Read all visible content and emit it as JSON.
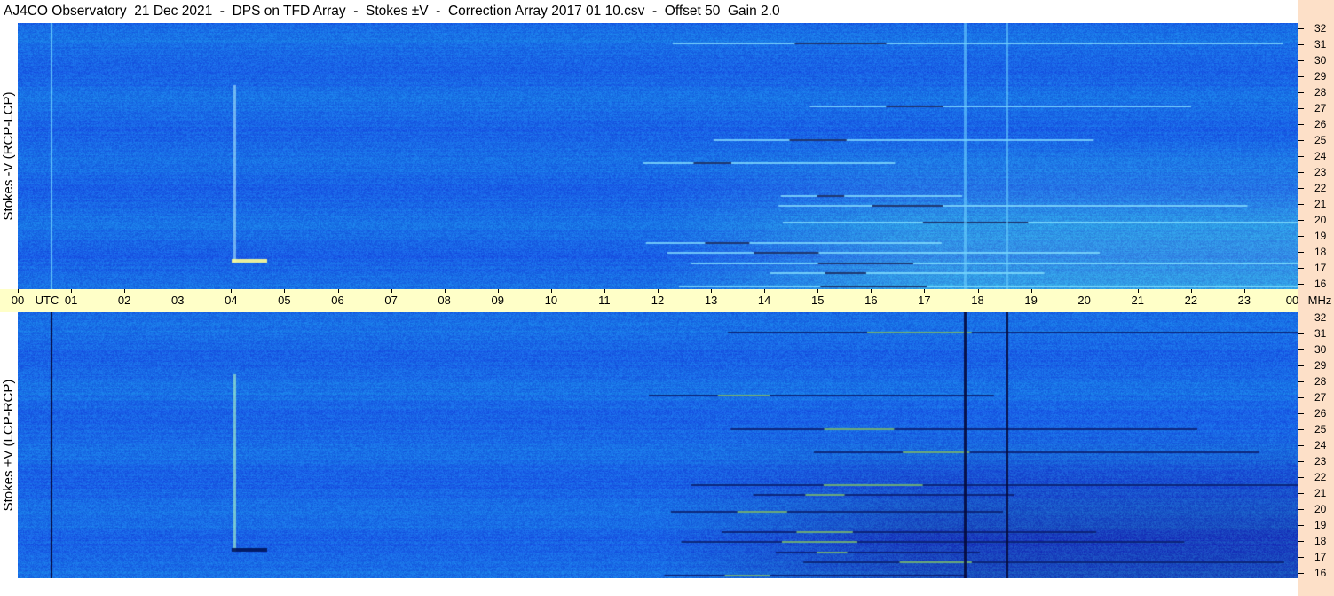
{
  "title": "AJ4CO Observatory  21 Dec 2021  -  DPS on TFD Array  -  Stokes ±V  -  Correction Array 2017 01 10.csv  -  Offset 50  Gain 2.0",
  "top_panel_label": "Stokes -V (RCP-LCP)",
  "bottom_panel_label": "Stokes +V (LCP-RCP)",
  "utc_axis": {
    "ticks": [
      "00",
      "01",
      "02",
      "03",
      "04",
      "05",
      "06",
      "07",
      "08",
      "09",
      "10",
      "11",
      "12",
      "13",
      "14",
      "15",
      "16",
      "17",
      "18",
      "19",
      "20",
      "21",
      "22",
      "23",
      "00"
    ],
    "unit_label": "UTC",
    "end_unit": "MHz"
  },
  "mhz_axis": {
    "ticks": [
      "32",
      "31",
      "30",
      "29",
      "28",
      "27",
      "26",
      "25",
      "24",
      "23",
      "22",
      "21",
      "20",
      "19",
      "18",
      "17",
      "16"
    ]
  },
  "colors": {
    "background_spectrogram": "#1b6be6",
    "utc_band": "#ffffc8",
    "right_strip": "#fde0c8"
  },
  "chart_data": {
    "type": "heatmap",
    "title": "AJ4CO Observatory  21 Dec 2021  -  DPS on TFD Array  -  Stokes ±V  -  Correction Array 2017 01 10.csv  -  Offset 50  Gain 2.0",
    "panels": [
      "Stokes -V (RCP-LCP)",
      "Stokes +V (LCP-RCP)"
    ],
    "x_axis": {
      "label": "UTC",
      "range": [
        0,
        24
      ],
      "unit": "hour"
    },
    "y_axis": {
      "label": "MHz",
      "range": [
        16,
        32
      ],
      "unit": "MHz"
    }
  }
}
